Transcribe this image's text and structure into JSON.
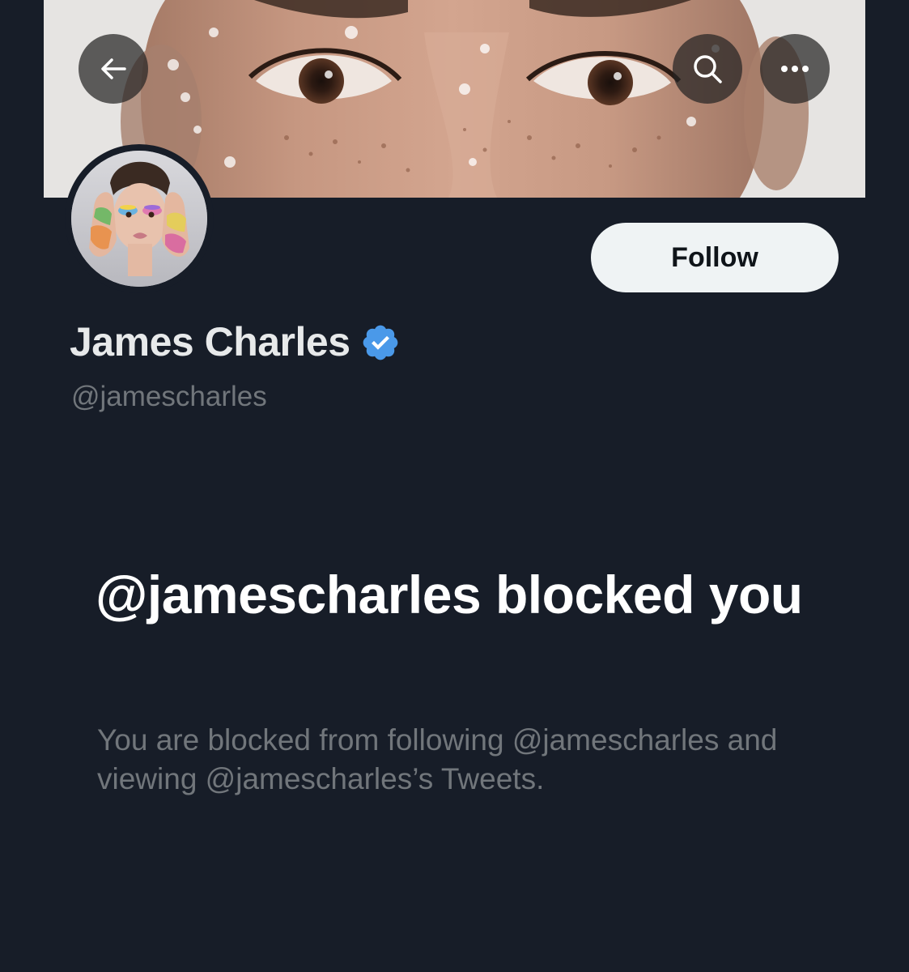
{
  "header": {
    "back_icon": "arrow-left-icon",
    "search_icon": "search-icon",
    "more_icon": "more-dots-icon"
  },
  "profile": {
    "display_name": "James Charles",
    "verified": true,
    "verified_color": "#4a99e9",
    "handle": "@jamescharles",
    "follow_label": "Follow"
  },
  "blocked_notice": {
    "title": "@jamescharles blocked you",
    "description": "You are blocked from following @jamescharles and viewing @jamescharles’s Tweets."
  },
  "colors": {
    "background": "#171d28",
    "follow_button_bg": "#eff3f4",
    "primary_text": "#e7e9ea",
    "secondary_text": "#71767b"
  }
}
